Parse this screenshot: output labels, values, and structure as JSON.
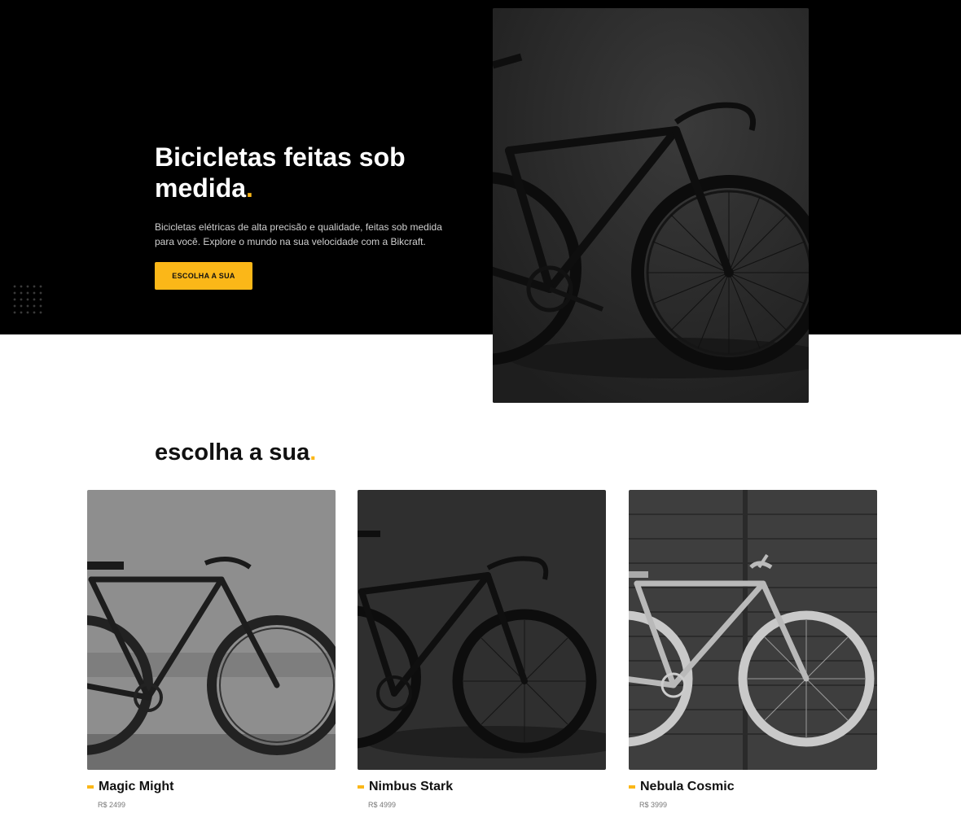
{
  "hero": {
    "title": "Bicicletas feitas sob medida",
    "title_dot": ".",
    "description": "Bicicletas elétricas de alta precisão e qualidade, feitas sob medida para você. Explore o mundo na sua velocidade com a Bikcraft.",
    "button_label": "ESCOLHA A SUA",
    "accent_color": "#fbb718"
  },
  "products_section": {
    "title": "escolha a sua",
    "title_dot": "."
  },
  "products": [
    {
      "name": "Magic Might",
      "price": "R$ 2499"
    },
    {
      "name": "Nimbus Stark",
      "price": "R$ 4999"
    },
    {
      "name": "Nebula Cosmic",
      "price": "R$ 3999"
    }
  ]
}
